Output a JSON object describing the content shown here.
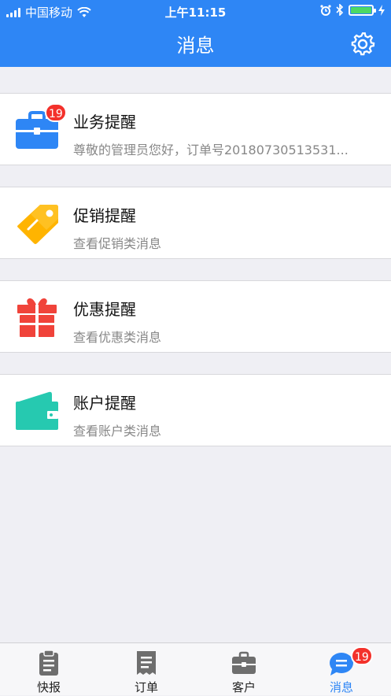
{
  "status_bar": {
    "carrier": "中国移动",
    "time": "上午11:15"
  },
  "header": {
    "title": "消息",
    "settings_icon": "gear-icon"
  },
  "messages": [
    {
      "title": "业务提醒",
      "subtitle": "尊敬的管理员您好，订单号20180730513531...",
      "badge": "19",
      "icon": "briefcase-icon",
      "color": "#2e86f5"
    },
    {
      "title": "促销提醒",
      "subtitle": "查看促销类消息",
      "icon": "tag-icon",
      "color": "#ffb400"
    },
    {
      "title": "优惠提醒",
      "subtitle": "查看优惠类消息",
      "icon": "gift-icon",
      "color": "#f0433a"
    },
    {
      "title": "账户提醒",
      "subtitle": "查看账户类消息",
      "icon": "wallet-icon",
      "color": "#26c9b0"
    }
  ],
  "tabbar": {
    "tabs": [
      {
        "label": "快报",
        "icon": "clipboard-icon"
      },
      {
        "label": "订单",
        "icon": "receipt-icon"
      },
      {
        "label": "客户",
        "icon": "briefcase-icon"
      },
      {
        "label": "消息",
        "icon": "chat-bubble-icon",
        "badge": "19",
        "active": true
      }
    ]
  },
  "colors": {
    "primary": "#2e86f5",
    "badge": "#f3312b",
    "background": "#efeff4"
  }
}
